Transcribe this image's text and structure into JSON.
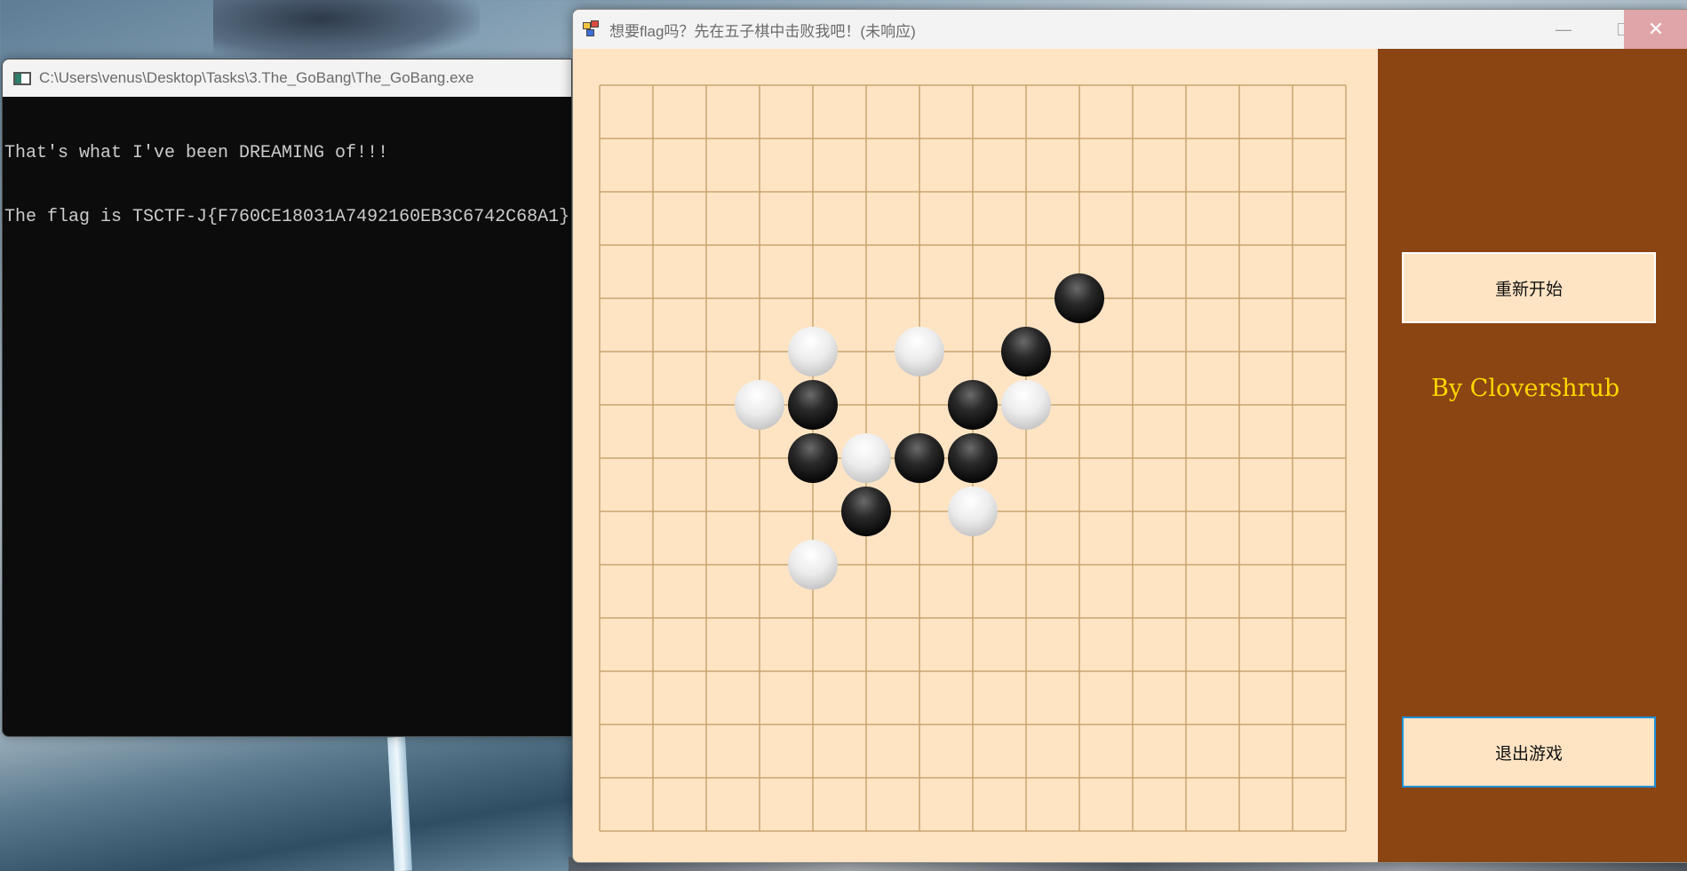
{
  "console_window": {
    "title": "C:\\Users\\venus\\Desktop\\Tasks\\3.The_GoBang\\The_GoBang.exe",
    "output_lines": [
      "That's what I've been DREAMING of!!!",
      "The flag is TSCTF-J{F760CE18031A7492160EB3C6742C68A1}"
    ]
  },
  "game_window": {
    "title": "想要flag吗？先在五子棋中击败我吧！(未响应)",
    "controls": {
      "minimize": "—",
      "maximize": "",
      "close": "✕"
    },
    "colors": {
      "board": "#ffe4c4",
      "grid": "#c8a46e",
      "panel": "#8b4513",
      "credit": "#ffd700"
    }
  },
  "board": {
    "grid_lines": 15,
    "stones": [
      {
        "col": 9,
        "row": 4,
        "color": "black"
      },
      {
        "col": 4,
        "row": 5,
        "color": "white"
      },
      {
        "col": 6,
        "row": 5,
        "color": "white"
      },
      {
        "col": 8,
        "row": 5,
        "color": "black"
      },
      {
        "col": 3,
        "row": 6,
        "color": "white"
      },
      {
        "col": 4,
        "row": 6,
        "color": "black"
      },
      {
        "col": 7,
        "row": 6,
        "color": "black"
      },
      {
        "col": 8,
        "row": 6,
        "color": "white"
      },
      {
        "col": 4,
        "row": 7,
        "color": "black"
      },
      {
        "col": 5,
        "row": 7,
        "color": "white"
      },
      {
        "col": 6,
        "row": 7,
        "color": "black"
      },
      {
        "col": 7,
        "row": 7,
        "color": "black"
      },
      {
        "col": 5,
        "row": 8,
        "color": "black"
      },
      {
        "col": 7,
        "row": 8,
        "color": "white"
      },
      {
        "col": 4,
        "row": 9,
        "color": "white"
      }
    ]
  },
  "side_panel": {
    "restart_label": "重新开始",
    "credit": "By Clovershrub",
    "exit_label": "退出游戏"
  }
}
